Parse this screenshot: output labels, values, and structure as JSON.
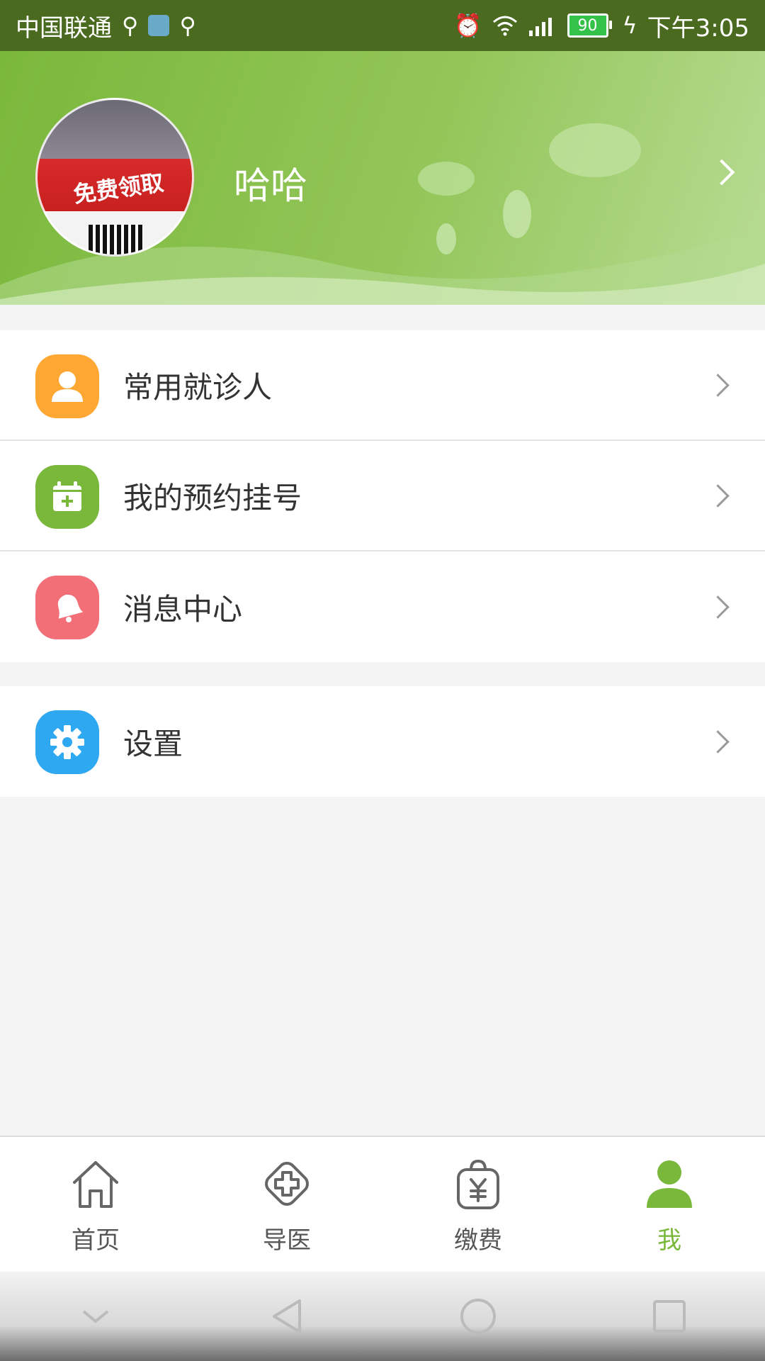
{
  "status_bar": {
    "carrier": "中国联通",
    "battery": "90",
    "time": "下午3:05"
  },
  "profile": {
    "username": "哈哈",
    "avatar_text": "免费领取"
  },
  "menu": {
    "group1": [
      {
        "label": "常用就诊人",
        "icon": "user-icon",
        "color": "#ffa733"
      },
      {
        "label": "我的预约挂号",
        "icon": "calendar-add-icon",
        "color": "#7ab83b"
      },
      {
        "label": "消息中心",
        "icon": "bell-icon",
        "color": "#f26f77"
      }
    ],
    "group2": [
      {
        "label": "设置",
        "icon": "gear-icon",
        "color": "#2ea8f0"
      }
    ]
  },
  "tabbar": {
    "tabs": [
      {
        "label": "首页",
        "icon": "home-icon"
      },
      {
        "label": "导医",
        "icon": "medical-cross-icon"
      },
      {
        "label": "缴费",
        "icon": "payment-bag-icon"
      },
      {
        "label": "我",
        "icon": "person-icon"
      }
    ],
    "active_index": 3,
    "active_color": "#7ab83b"
  },
  "system_nav": {
    "buttons": [
      "hide-keyboard-icon",
      "back-icon",
      "home-circle-icon",
      "recents-icon"
    ]
  }
}
